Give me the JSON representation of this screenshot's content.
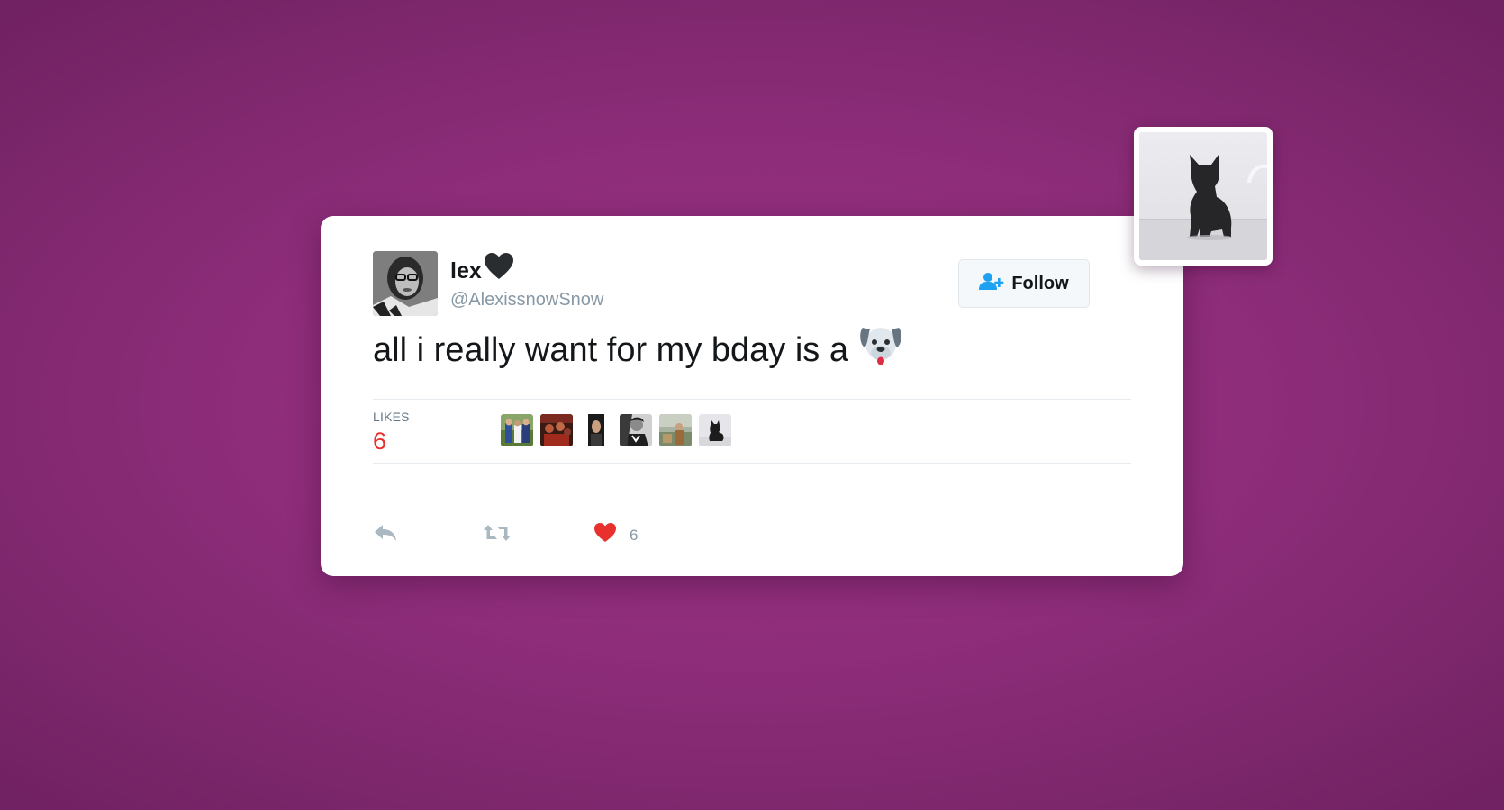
{
  "tweet": {
    "display_name": "lex",
    "name_emoji_icon": "black-heart-icon",
    "handle": "@AlexissnowSnow",
    "text": "all i really want for my bday is a",
    "text_emoji_icon": "dog-face-icon",
    "follow_label": "Follow",
    "follow_icon": "add-user-icon"
  },
  "stats": {
    "likes_label": "LIKES",
    "likes_count": "6",
    "liker_avatars": [
      "liker-1",
      "liker-2",
      "liker-3",
      "liker-4",
      "liker-5",
      "liker-6"
    ]
  },
  "actions": {
    "reply_icon": "reply-icon",
    "retweet_icon": "retweet-icon",
    "like_icon": "heart-icon",
    "like_count": "6"
  },
  "colors": {
    "background": "#962f80",
    "accent_blue": "#1da1f2",
    "like_red": "#e8302c",
    "muted_gray": "#8899a6"
  }
}
